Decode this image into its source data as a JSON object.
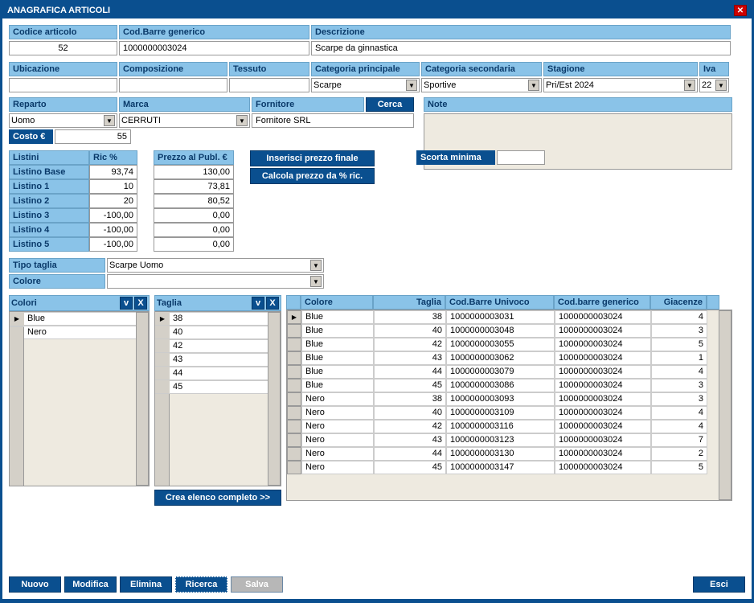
{
  "title": "ANAGRAFICA ARTICOLI",
  "section1": {
    "h": {
      "codice": "Codice articolo",
      "barre": "Cod.Barre generico",
      "descr": "Descrizione"
    },
    "v": {
      "codice": "52",
      "barre": "1000000003024",
      "descr": "Scarpe da ginnastica"
    }
  },
  "section2": {
    "h": {
      "ubic": "Ubicazione",
      "comp": "Composizione",
      "tess": "Tessuto",
      "catp": "Categoria principale",
      "cats": "Categoria secondaria",
      "stag": "Stagione",
      "iva": "Iva"
    },
    "v": {
      "catp": "Scarpe",
      "cats": "Sportive",
      "stag": "Pri/Est 2024",
      "iva": "22"
    }
  },
  "section3": {
    "h": {
      "rep": "Reparto",
      "marca": "Marca",
      "forn": "Fornitore",
      "cerca": "Cerca",
      "note": "Note"
    },
    "v": {
      "rep": "Uomo",
      "marca": "CERRUTI",
      "forn": "Fornitore SRL"
    }
  },
  "costo": {
    "label": "Costo €",
    "value": "55"
  },
  "listini": {
    "h": {
      "listini": "Listini",
      "ric": "Ric %",
      "pubb": "Prezzo al Publ. €"
    },
    "rows": [
      {
        "n": "Listino Base",
        "r": "93,74",
        "p": "130,00"
      },
      {
        "n": "Listino 1",
        "r": "10",
        "p": "73,81"
      },
      {
        "n": "Listino 2",
        "r": "20",
        "p": "80,52"
      },
      {
        "n": "Listino 3",
        "r": "-100,00",
        "p": "0,00"
      },
      {
        "n": "Listino 4",
        "r": "-100,00",
        "p": "0,00"
      },
      {
        "n": "Listino 5",
        "r": "-100,00",
        "p": "0,00"
      }
    ]
  },
  "btns": {
    "insPrezzo": "Inserisci prezzo finale",
    "calcPrezzo": "Calcola prezzo da % ric.",
    "creaElenco": "Crea elenco completo >>"
  },
  "scorta": {
    "label": "Scorta minima",
    "value": ""
  },
  "tipoTaglia": {
    "label": "Tipo taglia",
    "value": "Scarpe Uomo"
  },
  "colore": {
    "label": "Colore"
  },
  "colori": {
    "h": "Colori",
    "items": [
      "Blue",
      "Nero"
    ]
  },
  "taglia": {
    "h": "Taglia",
    "items": [
      "38",
      "40",
      "42",
      "43",
      "44",
      "45"
    ]
  },
  "mainGrid": {
    "h": {
      "col": "Colore",
      "tag": "Taglia",
      "uniq": "Cod.Barre Univoco",
      "gen": "Cod.barre generico",
      "giac": "Giacenze"
    },
    "rows": [
      {
        "c": "Blue",
        "t": "38",
        "u": "1000000003031",
        "g": "1000000003024",
        "q": "4"
      },
      {
        "c": "Blue",
        "t": "40",
        "u": "1000000003048",
        "g": "1000000003024",
        "q": "3"
      },
      {
        "c": "Blue",
        "t": "42",
        "u": "1000000003055",
        "g": "1000000003024",
        "q": "5"
      },
      {
        "c": "Blue",
        "t": "43",
        "u": "1000000003062",
        "g": "1000000003024",
        "q": "1"
      },
      {
        "c": "Blue",
        "t": "44",
        "u": "1000000003079",
        "g": "1000000003024",
        "q": "4"
      },
      {
        "c": "Blue",
        "t": "45",
        "u": "1000000003086",
        "g": "1000000003024",
        "q": "3"
      },
      {
        "c": "Nero",
        "t": "38",
        "u": "1000000003093",
        "g": "1000000003024",
        "q": "3"
      },
      {
        "c": "Nero",
        "t": "40",
        "u": "1000000003109",
        "g": "1000000003024",
        "q": "4"
      },
      {
        "c": "Nero",
        "t": "42",
        "u": "1000000003116",
        "g": "1000000003024",
        "q": "4"
      },
      {
        "c": "Nero",
        "t": "43",
        "u": "1000000003123",
        "g": "1000000003024",
        "q": "7"
      },
      {
        "c": "Nero",
        "t": "44",
        "u": "1000000003130",
        "g": "1000000003024",
        "q": "2"
      },
      {
        "c": "Nero",
        "t": "45",
        "u": "1000000003147",
        "g": "1000000003024",
        "q": "5"
      }
    ]
  },
  "footer": {
    "nuovo": "Nuovo",
    "modifica": "Modifica",
    "elimina": "Elimina",
    "ricerca": "Ricerca",
    "salva": "Salva",
    "esci": "Esci"
  }
}
